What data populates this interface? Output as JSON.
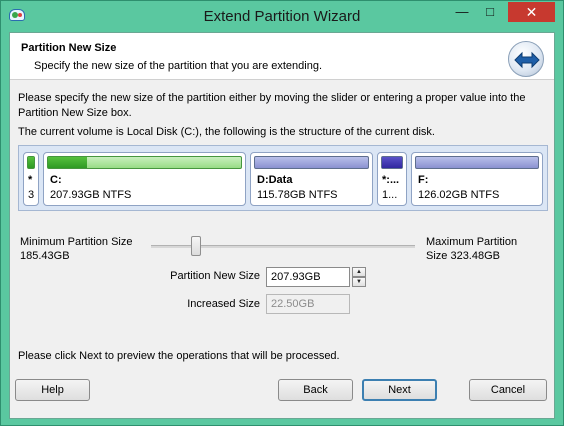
{
  "window": {
    "title": "Extend Partition Wizard",
    "minimize_glyph": "—",
    "maximize_glyph": "□",
    "close_glyph": "✕"
  },
  "header": {
    "title": "Partition New Size",
    "subtitle": "Specify the new size of the partition that you are extending."
  },
  "description": {
    "line1": "Please specify the new size of the partition either by moving the slider or entering a proper value into the Partition New Size box.",
    "line2": "The current volume is Local Disk (C:), the following is the structure of the current disk."
  },
  "disk_map": {
    "partitions": [
      {
        "label": "*",
        "size": "3",
        "used_fraction": 1.0,
        "color": "green"
      },
      {
        "label": "C:",
        "size": "207.93GB NTFS",
        "used_fraction": 0.2,
        "color": "green"
      },
      {
        "label": "D:Data",
        "size": "115.78GB NTFS",
        "used_fraction": 0.0,
        "color": "blue"
      },
      {
        "label": "*:...",
        "size": "1...",
        "used_fraction": 1.0,
        "color": "blue"
      },
      {
        "label": "F:",
        "size": "126.02GB NTFS",
        "used_fraction": 0.0,
        "color": "blue"
      }
    ]
  },
  "slider": {
    "min_label": "Minimum Partition Size",
    "min_value": "185.43GB",
    "max_label": "Maximum Partition",
    "max_value": "Size 323.48GB"
  },
  "fields": {
    "new_size_label": "Partition New Size",
    "new_size_value": "207.93GB",
    "increased_label": "Increased Size",
    "increased_value": "22.50GB"
  },
  "footer": {
    "note": "Please click Next to preview the operations that will be processed.",
    "help": "Help",
    "back": "Back",
    "next": "Next",
    "cancel": "Cancel"
  },
  "colors": {
    "title_bar": "#5ac8a0",
    "close_button": "#c7392f",
    "used_green": "#2f9a24",
    "used_blue": "#3027a0"
  }
}
